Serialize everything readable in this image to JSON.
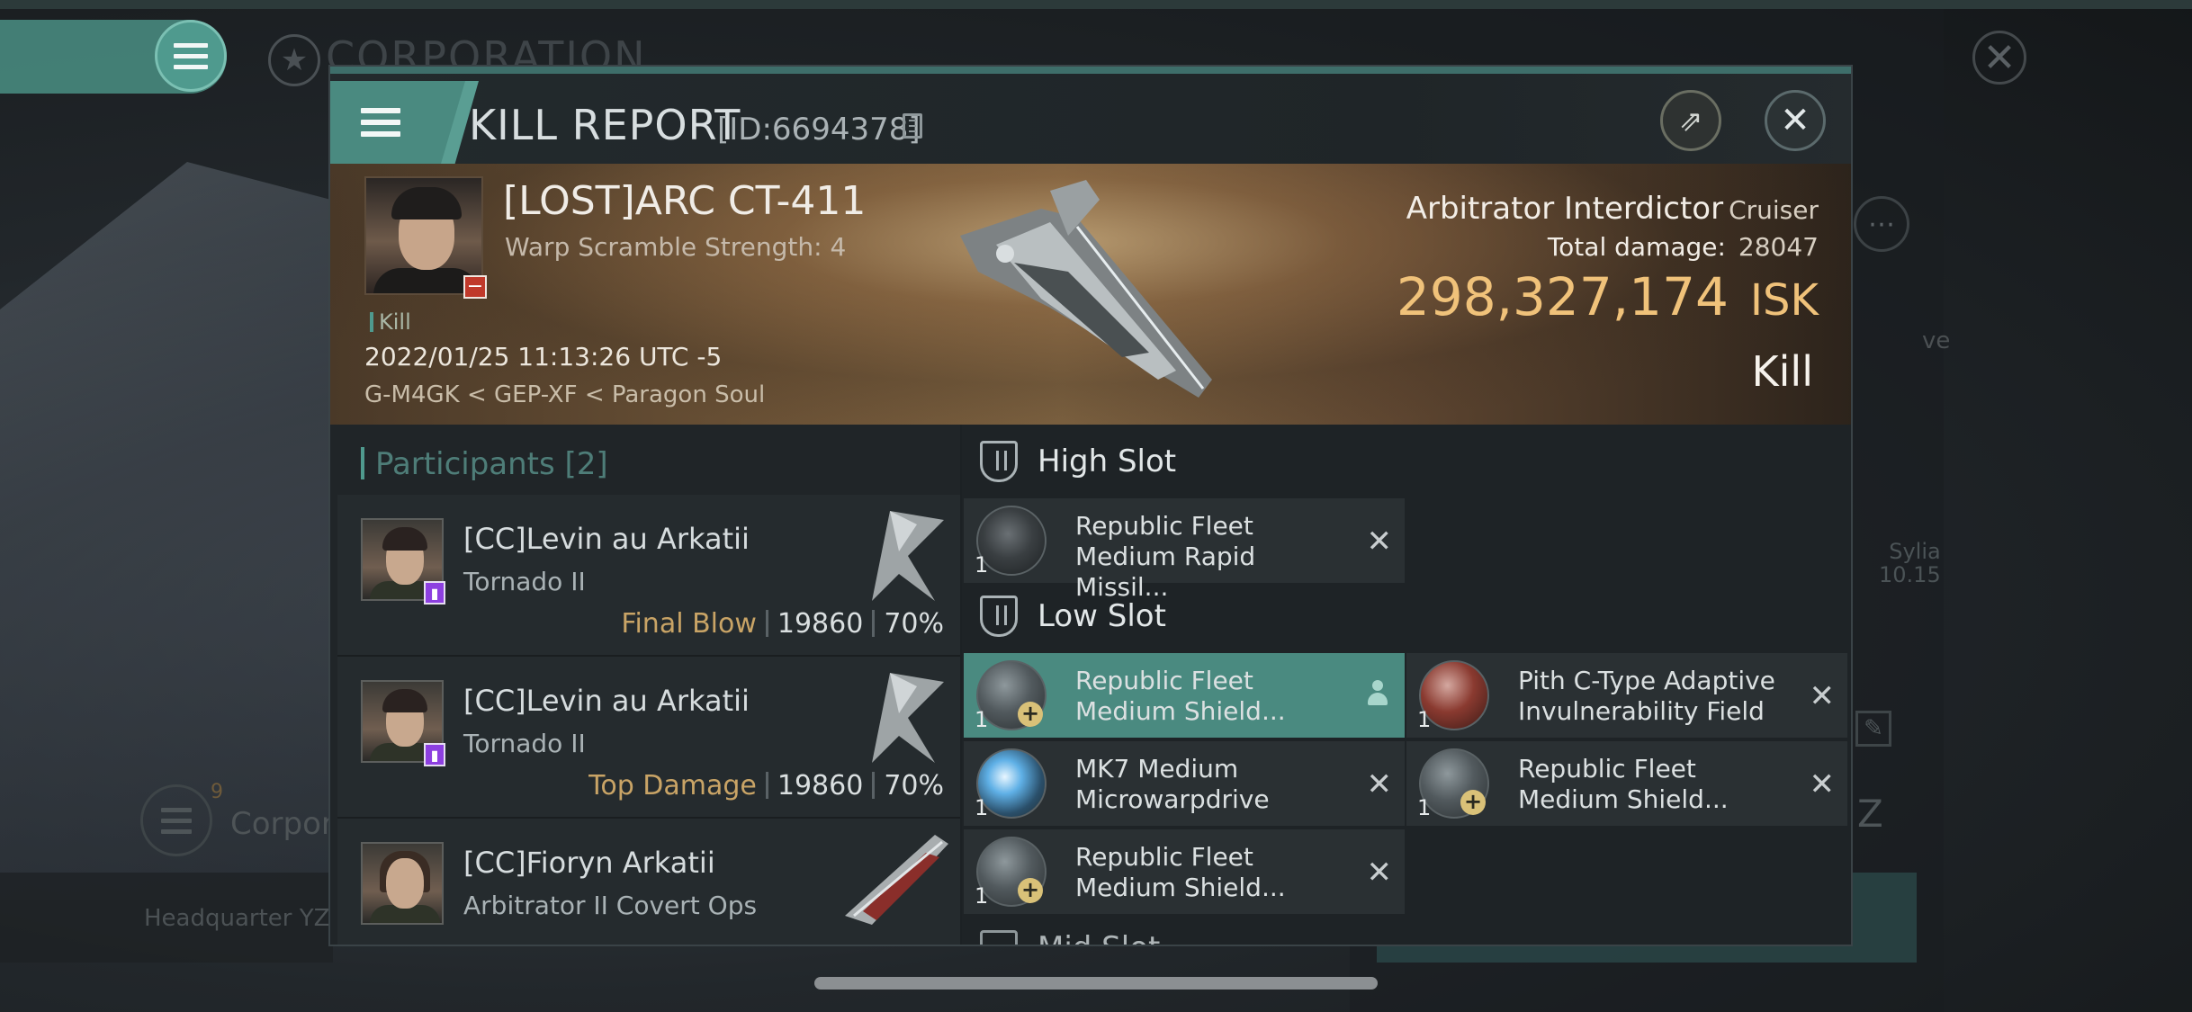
{
  "background": {
    "corporation_title": "CORPORATION",
    "corpo_label": "Corpora",
    "corpo_badge": "9",
    "headquarter_label": "Headquarter YZ-",
    "side_text_ve": "ve",
    "side_text_sylia": "Sylia",
    "side_text_date": "10.15"
  },
  "modal": {
    "title": "KILL REPORT",
    "id": "[ID:6694378]",
    "victim": {
      "name": "[LOST]ARC CT-411",
      "warp_scramble": "Warp Scramble Strength: 4",
      "kill_tag": "Kill",
      "datetime": "2022/01/25 11:13:26 UTC -5",
      "location": "G-M4GK < GEP-XF < Paragon Soul"
    },
    "ship": {
      "type": "Arbitrator Interdictor",
      "class": "Cruiser",
      "total_damage_label": "Total damage:",
      "total_damage_value": "28047",
      "isk_value": "298,327,174",
      "isk_unit": "ISK",
      "result": "Kill"
    },
    "participants": {
      "title": "Participants",
      "count": "[2]",
      "items": [
        {
          "name": "[CC]Levin au Arkatii",
          "ship": "Tornado II",
          "role": "Final Blow",
          "damage": "19860",
          "percent": "70%"
        },
        {
          "name": "[CC]Levin au Arkatii",
          "ship": "Tornado II",
          "role": "Top Damage",
          "damage": "19860",
          "percent": "70%"
        },
        {
          "name": "[CC]Fioryn Arkatii",
          "ship": "Arbitrator II Covert Ops"
        }
      ]
    },
    "fitting": {
      "high_slot_label": "High Slot",
      "low_slot_label": "Low Slot",
      "mid_slot_label": "Mid Slot",
      "high": [
        {
          "qty": "1",
          "line1": "Republic Fleet",
          "line2": "Medium Rapid Missil..."
        }
      ],
      "low": [
        {
          "qty": "1",
          "line1": "Republic Fleet",
          "line2": "Medium Shield..."
        },
        {
          "qty": "1",
          "line1": "Pith C-Type Adaptive",
          "line2": "Invulnerability Field"
        },
        {
          "qty": "1",
          "line1": "MK7 Medium",
          "line2": "Microwarpdrive"
        },
        {
          "qty": "1",
          "line1": "Republic Fleet",
          "line2": "Medium Shield..."
        },
        {
          "qty": "1",
          "line1": "Republic Fleet",
          "line2": "Medium Shield..."
        }
      ]
    }
  }
}
